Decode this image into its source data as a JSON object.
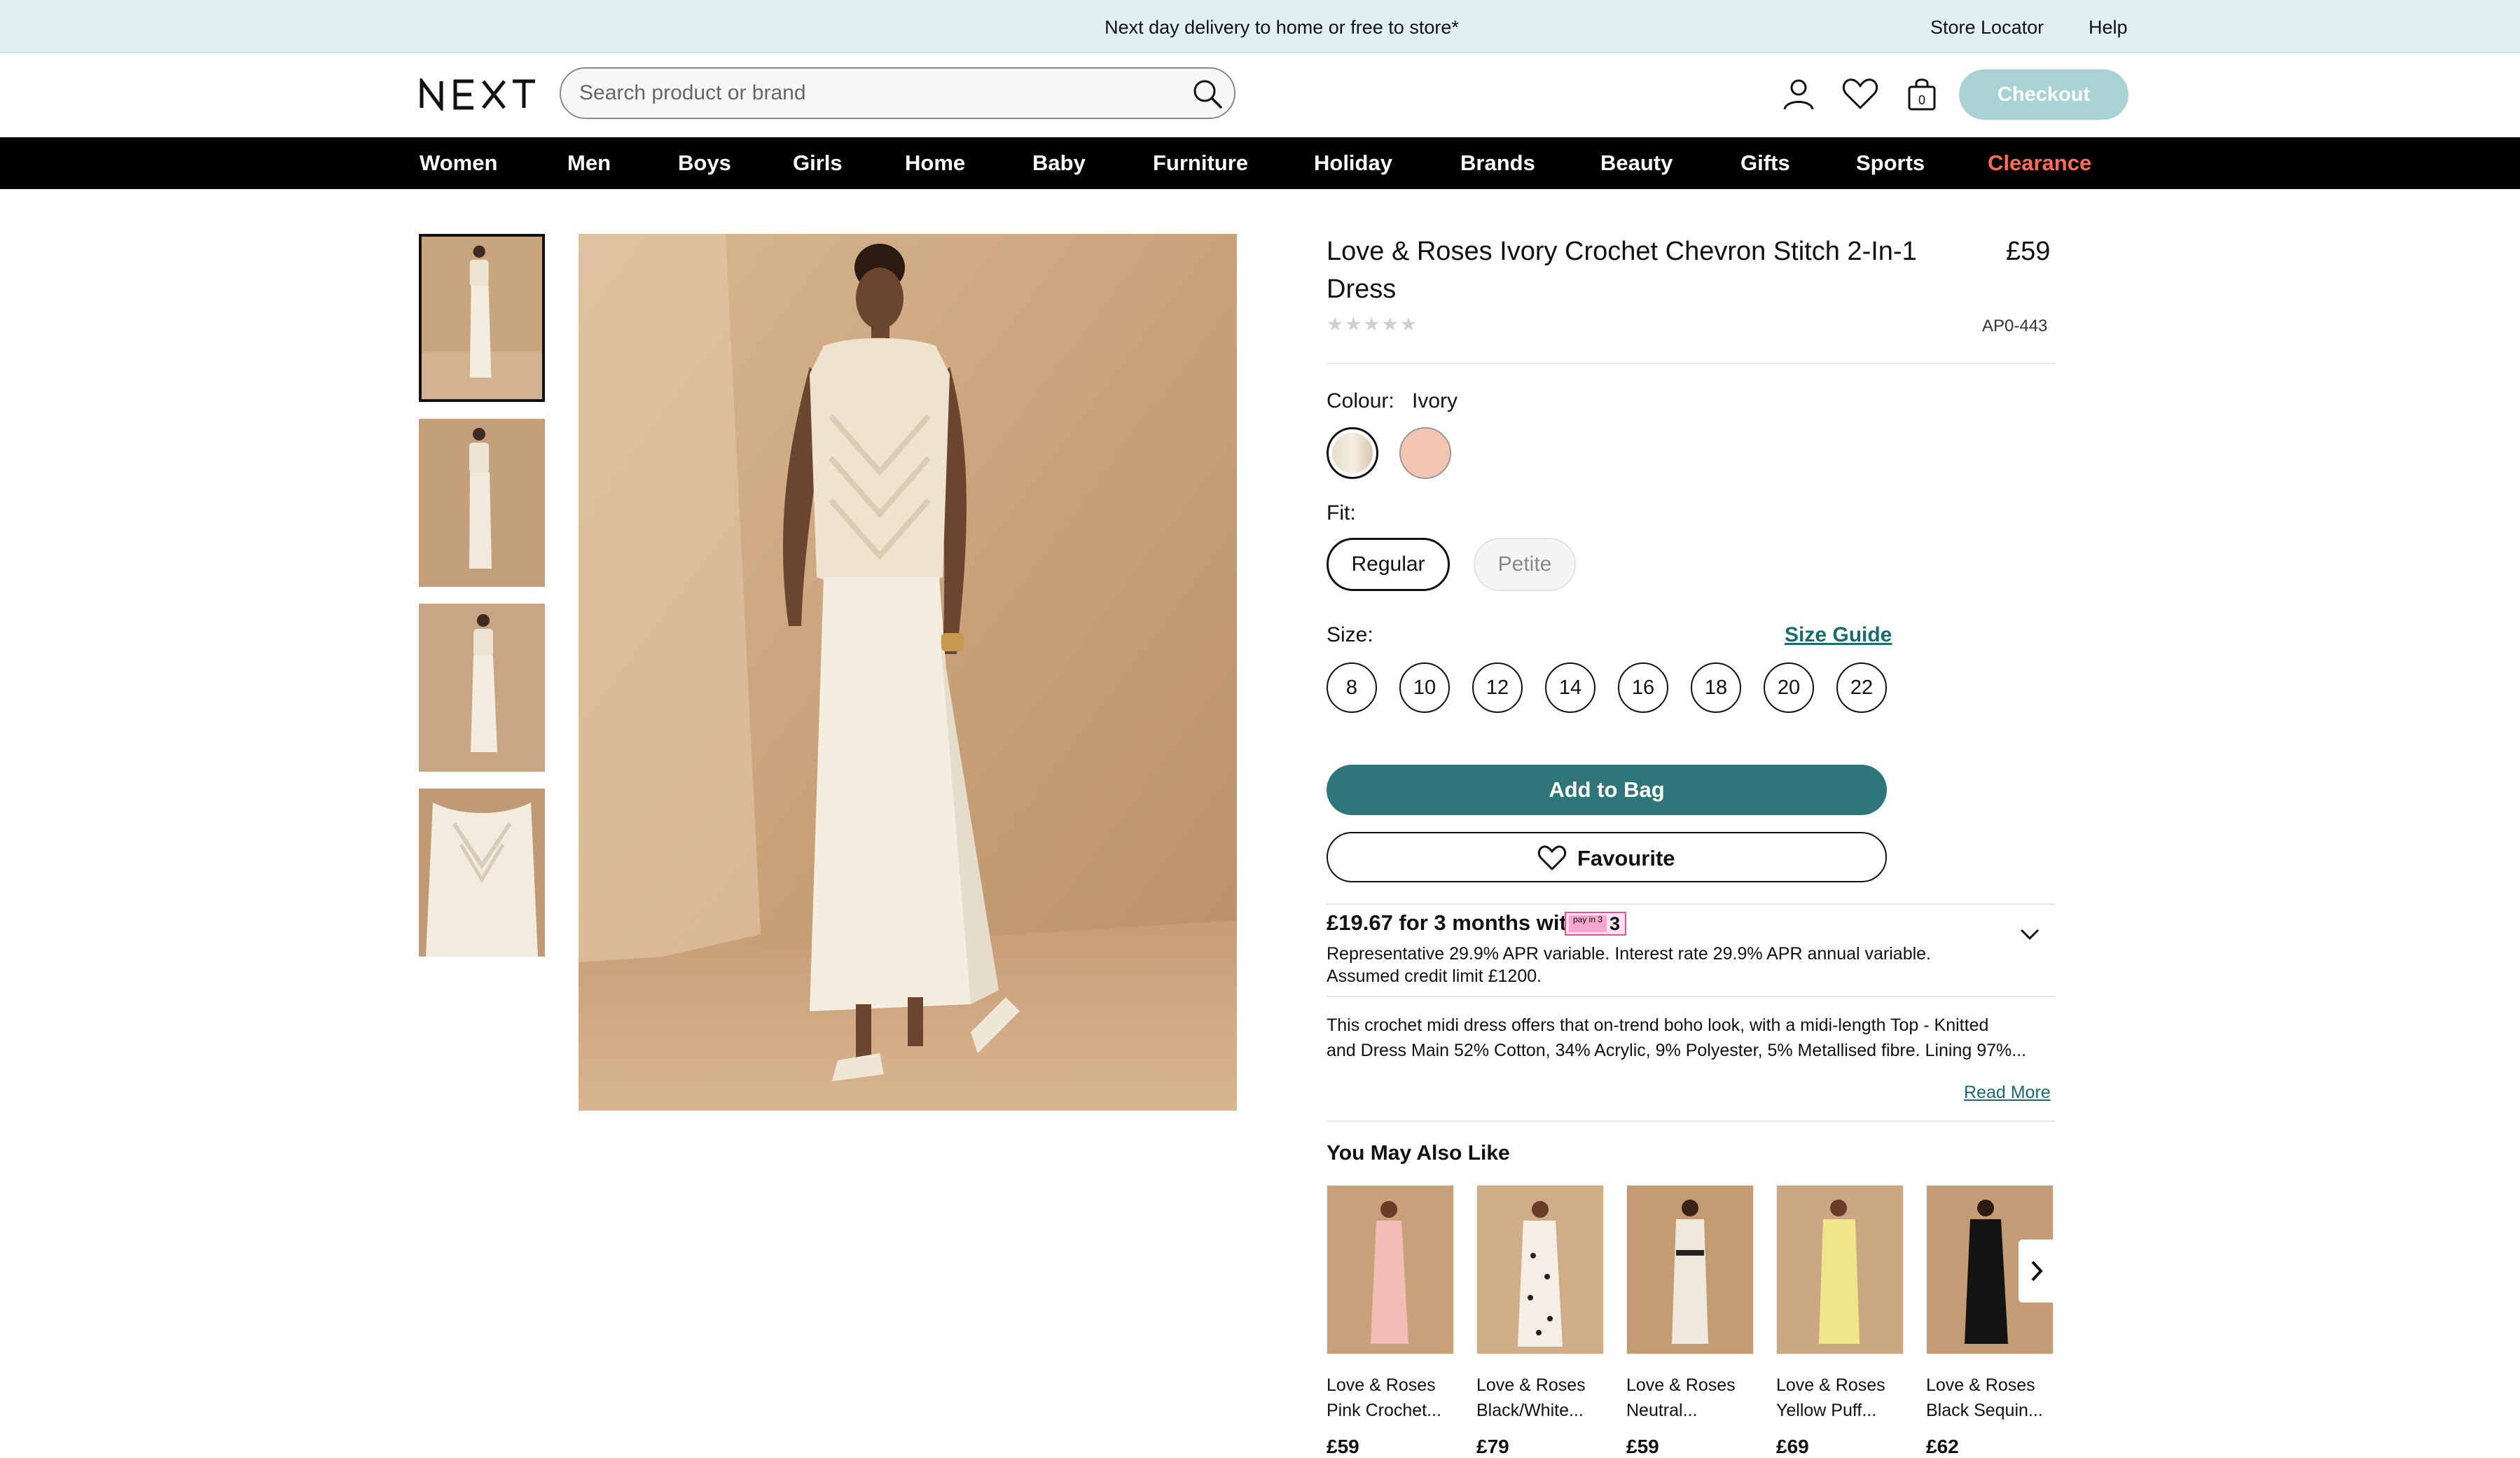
{
  "topbar": {
    "promo": "Next day delivery to home or free to store*",
    "store_locator": "Store Locator",
    "help": "Help"
  },
  "header": {
    "logo": "NEXT",
    "search_placeholder": "Search product or brand",
    "bag_count": "0",
    "checkout": "Checkout"
  },
  "nav": {
    "items": [
      "Women",
      "Men",
      "Boys",
      "Girls",
      "Home",
      "Baby",
      "Furniture",
      "Holiday",
      "Brands",
      "Beauty",
      "Gifts",
      "Sports",
      "Clearance"
    ]
  },
  "product": {
    "title": "Love & Roses Ivory Crochet Chevron Stitch 2-In-1 Dress",
    "price": "£59",
    "rating_stars": "★★★★★",
    "code": "AP0-443",
    "colour_label": "Colour:",
    "colour_value": "Ivory",
    "fit_label": "Fit:",
    "fit_options": [
      "Regular",
      "Petite"
    ],
    "size_label": "Size:",
    "size_guide": "Size Guide",
    "sizes": [
      "8",
      "10",
      "12",
      "14",
      "16",
      "18",
      "20",
      "22"
    ],
    "add_to_bag": "Add to Bag",
    "favourite": "Favourite"
  },
  "finance": {
    "headline": "£19.67 for 3 months with",
    "badge_small": "pay in 3",
    "badge_number": "3",
    "line1": "Representative 29.9% APR variable. Interest rate 29.9% APR annual variable.",
    "line2": "Assumed credit limit £1200."
  },
  "description": {
    "line1": "This crochet midi dress offers that on-trend boho look, with a midi-length Top - Knitted",
    "line2": "and Dress Main 52% Cotton, 34% Acrylic, 9% Polyester, 5% Metallised fibre. Lining 97%...",
    "read_more": "Read More"
  },
  "recommendations": {
    "title": "You May Also Like",
    "items": [
      {
        "name1": "Love & Roses",
        "name2": "Pink Crochet...",
        "price": "£59"
      },
      {
        "name1": "Love & Roses",
        "name2": "Black/White...",
        "price": "£79"
      },
      {
        "name1": "Love & Roses",
        "name2": "Neutral...",
        "price": "£59"
      },
      {
        "name1": "Love & Roses",
        "name2": "Yellow Puff...",
        "price": "£69"
      },
      {
        "name1": "Love & Roses",
        "name2": "Black Sequin...",
        "price": "£62"
      }
    ]
  },
  "colors": {
    "teal": "#2e7679",
    "checkout": "#a9d2d4",
    "clearance": "#ff6b57",
    "topbar": "#e1eff0"
  }
}
